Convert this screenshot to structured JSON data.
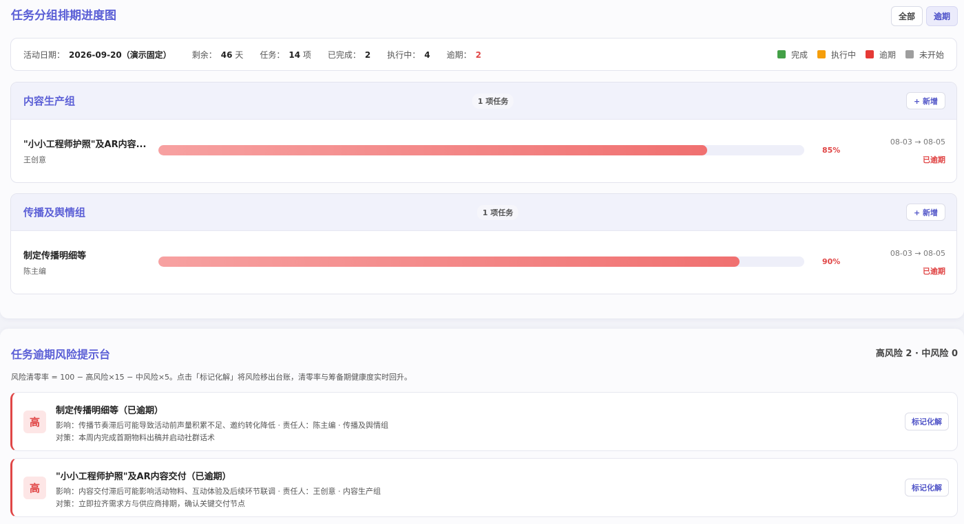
{
  "page": {
    "title": "任务分组排期进度图"
  },
  "filters": {
    "all_label": "全部",
    "overdue_label": "逾期"
  },
  "stats": {
    "event_date_label": "活动日期：",
    "event_date_value": "2026-09-20（演示固定）",
    "remaining_label": "剩余：",
    "remaining_value": "46",
    "remaining_unit": "天",
    "tasks_label": "任务：",
    "tasks_value": "14",
    "tasks_unit": "项",
    "done_label": "已完成：",
    "done_value": "2",
    "in_progress_label": "执行中：",
    "in_progress_value": "4",
    "overdue_label": "逾期：",
    "overdue_value": "2"
  },
  "legend": [
    {
      "label": "完成",
      "color": "#43a047"
    },
    {
      "label": "执行中",
      "color": "#f59e0b"
    },
    {
      "label": "逾期",
      "color": "#e53935"
    },
    {
      "label": "未开始",
      "color": "#9e9e9e"
    }
  ],
  "groups": [
    {
      "name": "内容生产组",
      "count": "1 项任务",
      "add_label": "+ 新增",
      "task": {
        "title": "\"小小工程师护照\"及AR内容...",
        "owner": "王创意",
        "progress": 85,
        "progress_label": "85%",
        "dates": "08-03 → 08-05",
        "status": "已逾期"
      }
    },
    {
      "name": "传播及舆情组",
      "count": "1 项任务",
      "add_label": "+ 新增",
      "task": {
        "title": "制定传播明细等",
        "owner": "陈主编",
        "progress": 90,
        "progress_label": "90%",
        "dates": "08-03 → 08-05",
        "status": "已逾期"
      }
    }
  ],
  "risk": {
    "title": "任务逾期风险提示台",
    "summary": "高风险 2 · 中风险 0",
    "description": "风险清零率 = 100 − 高风险×15 − 中风险×5。点击「标记化解」将风险移出台账，清零率与筹备期健康度实时回升。",
    "items": [
      {
        "level": "高",
        "name": "制定传播明细等（已逾期）",
        "impact": "影响：传播节奏滞后可能导致活动前声量积累不足、邀约转化降低 · 责任人：陈主编 · 传播及舆情组",
        "measure": "对策：本周内完成首期物料出稿并启动社群话术",
        "action_label": "标记化解"
      },
      {
        "level": "高",
        "name": "\"小小工程师护照\"及AR内容交付（已逾期）",
        "impact": "影响：内容交付滞后可能影响活动物料、互动体验及后续环节联调 · 责任人：王创意 · 内容生产组",
        "measure": "对策：立即拉齐需求方与供应商排期，确认关键交付节点",
        "action_label": "标记化解"
      }
    ]
  }
}
